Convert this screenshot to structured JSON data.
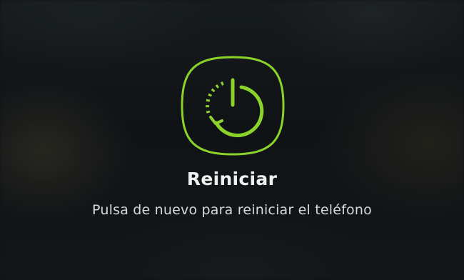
{
  "dialog": {
    "title": "Reiniciar",
    "subtitle": "Pulsa de nuevo para reiniciar el teléfono",
    "icon": "restart-power-icon",
    "accent_color": "#8bd22b"
  }
}
